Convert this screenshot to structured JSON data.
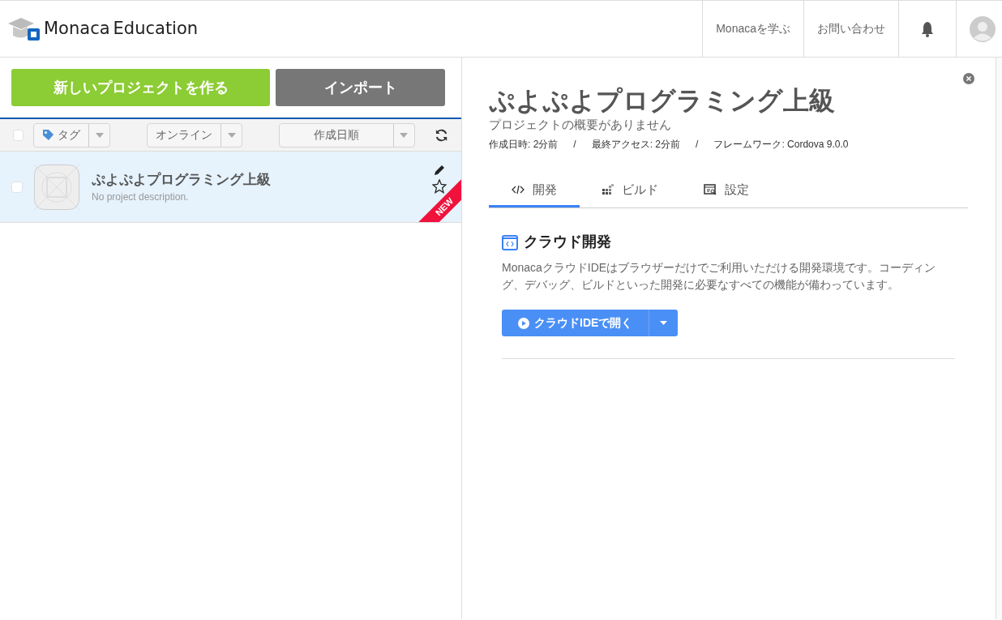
{
  "header": {
    "logo": {
      "brand": "Monaca",
      "suffix": "Education"
    },
    "nav": [
      "Monacaを学ぶ",
      "お問い合わせ"
    ]
  },
  "actions": {
    "create": "新しいプロジェクトを作る",
    "import": "インポート"
  },
  "filters": {
    "select_all": {
      "checked": false
    },
    "tag": "タグ",
    "status": "オンライン",
    "sort": "作成日順"
  },
  "projects": [
    {
      "name": "ぷよぷよプログラミング上級",
      "description": "No project description.",
      "checked": false,
      "selected": true,
      "starred": false,
      "ribbon": "NEW"
    }
  ],
  "detail": {
    "title": "ぷよぷよプログラミング上級",
    "summary": "プロジェクトの概要がありません",
    "meta": [
      "作成日時: 2分前",
      "/",
      "最終アクセス: 2分前",
      "/",
      "フレームワーク: Cordova 9.0.0"
    ],
    "tabs": [
      {
        "kind": "code",
        "label": "開発",
        "selected": true
      },
      {
        "kind": "build",
        "label": "ビルド",
        "selected": false
      },
      {
        "kind": "settings",
        "label": "設定",
        "selected": false
      }
    ],
    "section": {
      "title": "クラウド開発",
      "description": "MonacaクラウドIDEはブラウザーだけでご利用いただける開発環境です。コーディング、デバッグ、ビルドといった開発に必要なすべての機能が備わっています。",
      "button": "クラウドIDEで開く"
    }
  }
}
